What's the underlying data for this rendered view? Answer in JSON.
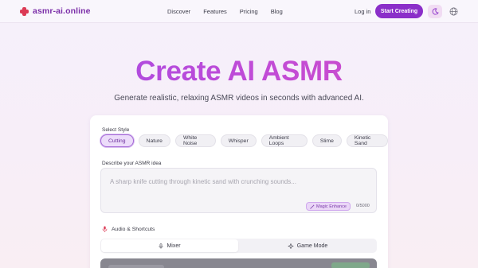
{
  "nav": {
    "brand": "asmr-ai.online",
    "links": [
      "Discover",
      "Features",
      "Pricing",
      "Blog"
    ],
    "login": "Log in",
    "cta": "Start Creating",
    "icons": {
      "logo": "cross-logo-icon",
      "theme": "moon-icon",
      "language": "globe-icon"
    }
  },
  "hero": {
    "title": "Create AI ASMR",
    "subtitle": "Generate realistic, relaxing ASMR videos in seconds with advanced AI."
  },
  "form": {
    "style_label": "Select Style",
    "styles": [
      "Cutting",
      "Nature",
      "White Noise",
      "Whisper",
      "Ambient Loops",
      "Slime",
      "Kinetic Sand"
    ],
    "selected_style": "Cutting",
    "idea_label": "Describe your ASMR idea",
    "idea_placeholder": "A sharp knife cutting through kinetic sand with crunching sounds...",
    "magic_enhance": "Magic Enhance",
    "char_count": "0/5000",
    "audio_label": "Audio & Shortcuts",
    "tabs": [
      "Mixer",
      "Game Mode"
    ],
    "active_tab": "Mixer"
  },
  "colors": {
    "brand_purple": "#8b2fc9",
    "logo_red": "#dc3a55",
    "title_gradient_start": "#a04be6",
    "title_gradient_end": "#d34fc6"
  }
}
